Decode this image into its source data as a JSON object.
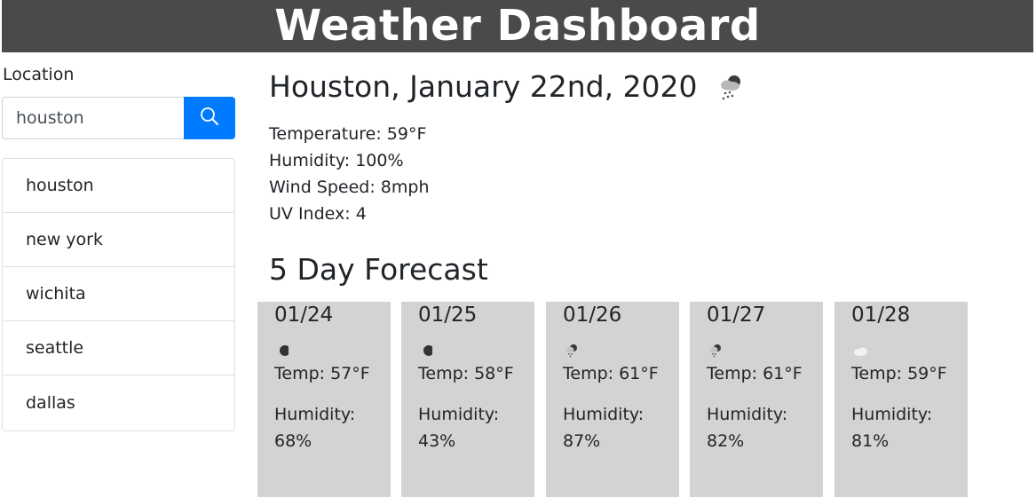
{
  "header": {
    "title": "Weather Dashboard"
  },
  "sidebar": {
    "location_label": "Location",
    "search_value": "houston",
    "history": [
      {
        "label": "houston"
      },
      {
        "label": "new york"
      },
      {
        "label": "wichita"
      },
      {
        "label": "seattle"
      },
      {
        "label": "dallas"
      }
    ]
  },
  "current": {
    "title": "Houston, January 22nd, 2020",
    "icon": "rain-cloud-icon",
    "temperature": "Temperature: 59°F",
    "humidity": "Humidity: 100%",
    "wind": "Wind Speed: 8mph",
    "uv": "UV Index: 4"
  },
  "forecast": {
    "title": "5 Day Forecast",
    "days": [
      {
        "date": "01/24",
        "icon": "dark-dot-icon",
        "temp": "Temp: 57°F",
        "humidity_label": "Humidity:",
        "humidity": "68%"
      },
      {
        "date": "01/25",
        "icon": "dark-dot-icon",
        "temp": "Temp: 58°F",
        "humidity_label": "Humidity:",
        "humidity": "43%"
      },
      {
        "date": "01/26",
        "icon": "rain-cloud-icon",
        "temp": "Temp: 61°F",
        "humidity_label": "Humidity:",
        "humidity": "87%"
      },
      {
        "date": "01/27",
        "icon": "rain-cloud-icon",
        "temp": "Temp: 61°F",
        "humidity_label": "Humidity:",
        "humidity": "82%"
      },
      {
        "date": "01/28",
        "icon": "cloud-icon",
        "temp": "Temp: 59°F",
        "humidity_label": "Humidity:",
        "humidity": "81%"
      }
    ]
  },
  "colors": {
    "header_bg": "#4a4a4a",
    "accent": "#007bff",
    "card_bg": "#d3d3d3"
  }
}
